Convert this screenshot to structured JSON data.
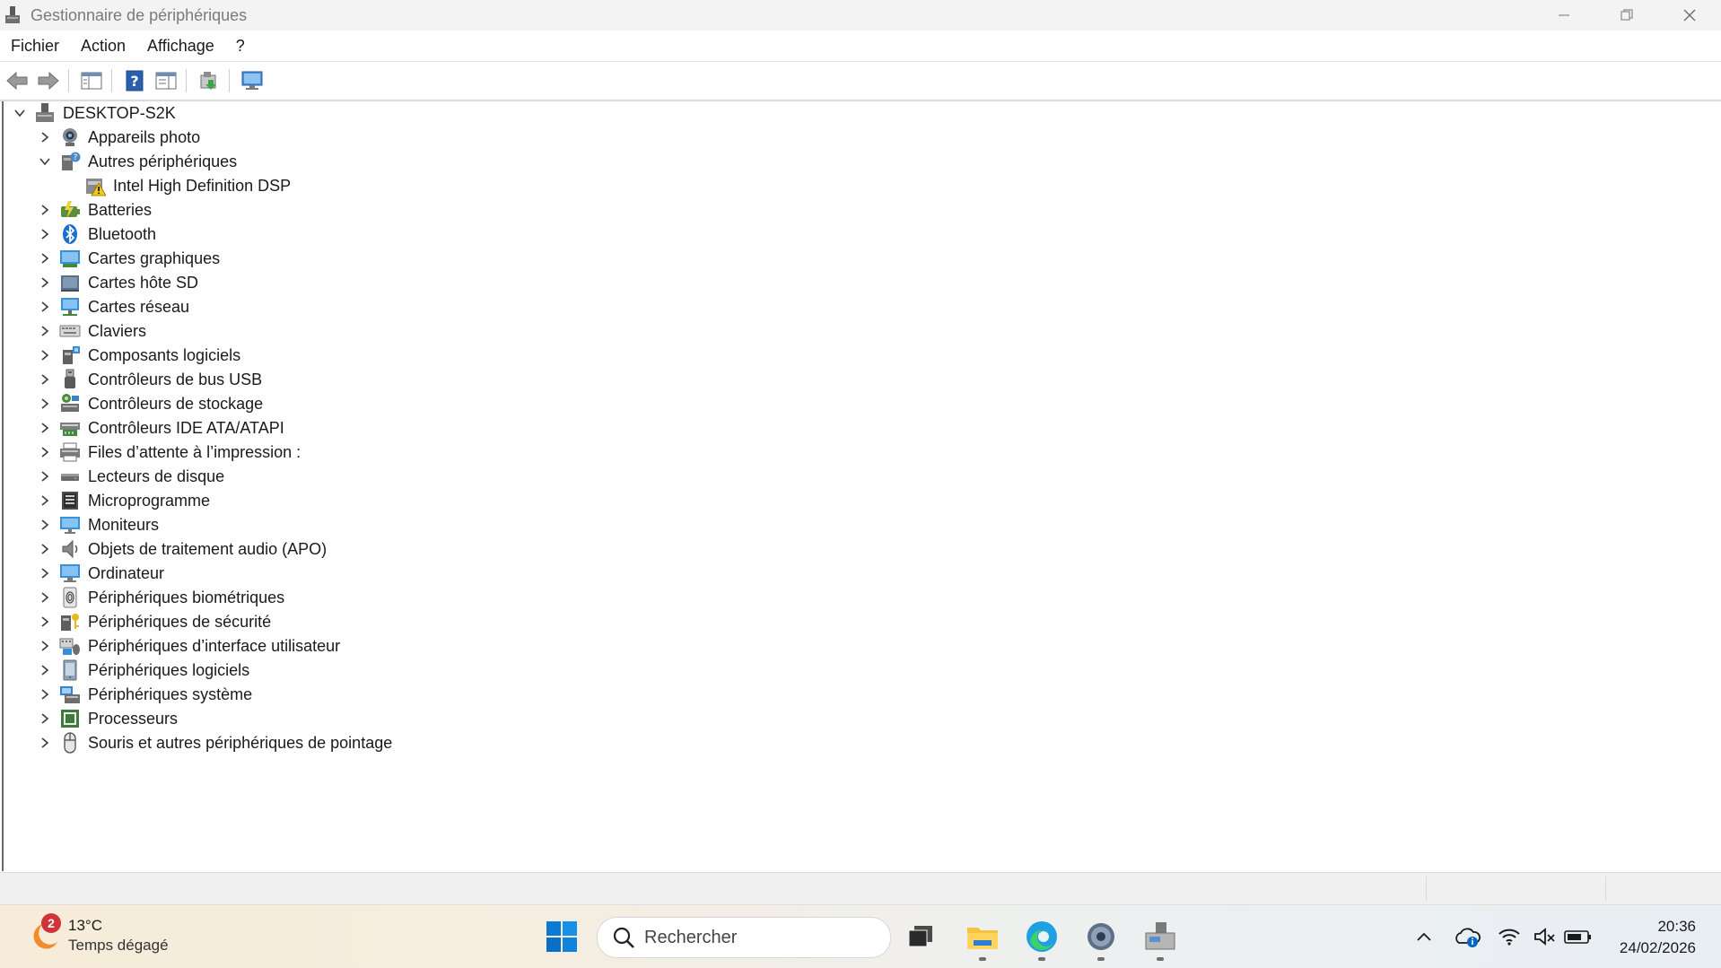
{
  "window": {
    "title": "Gestionnaire de périphériques"
  },
  "menu": {
    "items": [
      "Fichier",
      "Action",
      "Affichage",
      "?"
    ]
  },
  "tree": {
    "root": "DESKTOP-S2K",
    "items": [
      {
        "label": "Appareils photo",
        "expanded": false,
        "icon": "camera-icon"
      },
      {
        "label": "Autres périphériques",
        "expanded": true,
        "icon": "other-devices-icon",
        "children": [
          {
            "label": "Intel High Definition DSP",
            "icon": "warning-device-icon"
          }
        ]
      },
      {
        "label": "Batteries",
        "expanded": false,
        "icon": "battery-icon"
      },
      {
        "label": "Bluetooth",
        "expanded": false,
        "icon": "bluetooth-icon"
      },
      {
        "label": "Cartes graphiques",
        "expanded": false,
        "icon": "display-adapter-icon"
      },
      {
        "label": "Cartes hôte SD",
        "expanded": false,
        "icon": "sd-host-icon"
      },
      {
        "label": "Cartes réseau",
        "expanded": false,
        "icon": "network-adapter-icon"
      },
      {
        "label": "Claviers",
        "expanded": false,
        "icon": "keyboard-icon"
      },
      {
        "label": "Composants logiciels",
        "expanded": false,
        "icon": "software-component-icon"
      },
      {
        "label": "Contrôleurs de bus USB",
        "expanded": false,
        "icon": "usb-icon"
      },
      {
        "label": "Contrôleurs de stockage",
        "expanded": false,
        "icon": "storage-controller-icon"
      },
      {
        "label": "Contrôleurs IDE ATA/ATAPI",
        "expanded": false,
        "icon": "ide-controller-icon"
      },
      {
        "label": "Files d’attente à l’impression :",
        "expanded": false,
        "icon": "printer-icon"
      },
      {
        "label": "Lecteurs de disque",
        "expanded": false,
        "icon": "disk-drive-icon"
      },
      {
        "label": "Microprogramme",
        "expanded": false,
        "icon": "firmware-icon"
      },
      {
        "label": "Moniteurs",
        "expanded": false,
        "icon": "monitor-icon"
      },
      {
        "label": "Objets de traitement audio (APO)",
        "expanded": false,
        "icon": "speaker-icon"
      },
      {
        "label": "Ordinateur",
        "expanded": false,
        "icon": "computer-icon"
      },
      {
        "label": "Périphériques biométriques",
        "expanded": false,
        "icon": "fingerprint-icon"
      },
      {
        "label": "Périphériques de sécurité",
        "expanded": false,
        "icon": "security-device-icon"
      },
      {
        "label": "Périphériques d’interface utilisateur",
        "expanded": false,
        "icon": "hid-icon"
      },
      {
        "label": "Périphériques logiciels",
        "expanded": false,
        "icon": "software-device-icon"
      },
      {
        "label": "Périphériques système",
        "expanded": false,
        "icon": "system-device-icon"
      },
      {
        "label": "Processeurs",
        "expanded": false,
        "icon": "processor-icon"
      },
      {
        "label": "Souris et autres périphériques de pointage",
        "expanded": false,
        "icon": "mouse-icon"
      }
    ]
  },
  "taskbar": {
    "weather": {
      "badge": "2",
      "temp": "13°C",
      "desc": "Temps dégagé"
    },
    "search_placeholder": "Rechercher",
    "time": "20:36",
    "date": "24/02/2026"
  },
  "colors": {
    "accent": "#0078d4",
    "warning": "#f2c811",
    "badge": "#d13438"
  }
}
